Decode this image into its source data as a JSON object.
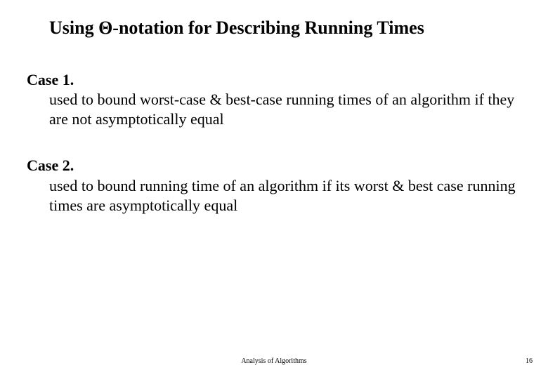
{
  "slide": {
    "title": "Using Θ-notation for Describing Running Times",
    "cases": [
      {
        "label": "Case 1.",
        "desc": "used to bound worst-case & best-case running times of an algorithm if they are not asymptotically equal"
      },
      {
        "label": "Case 2.",
        "desc": "used to bound running time of an algorithm if its worst & best case running times are asymptotically equal"
      }
    ],
    "footer": "Analysis of Algorithms",
    "page": "16"
  }
}
